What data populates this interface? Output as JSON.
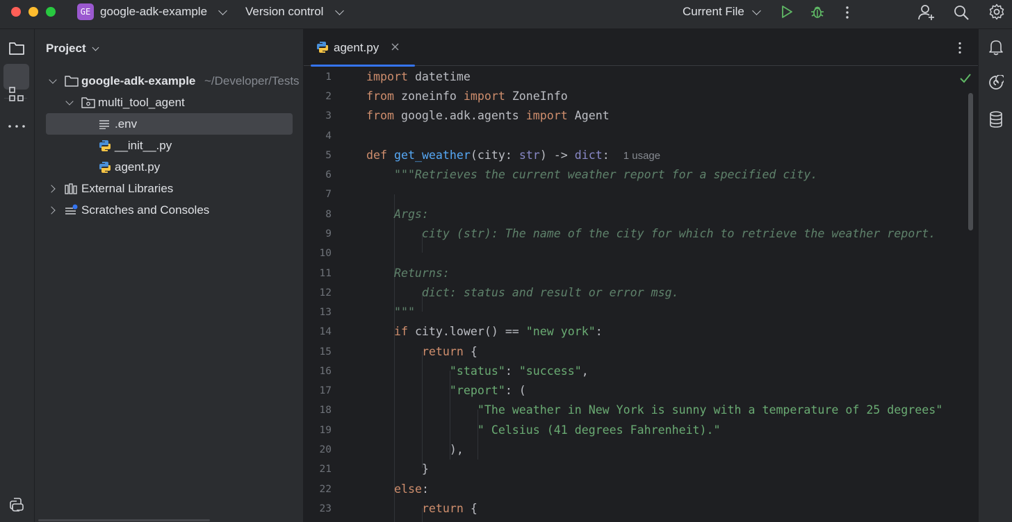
{
  "titlebar": {
    "project_badge": "GE",
    "project_name": "google-adk-example",
    "vcs_label": "Version control",
    "run_config": "Current File"
  },
  "project_panel": {
    "title": "Project",
    "tree": [
      {
        "label": "google-adk-example",
        "path": "~/Developer/Tests"
      },
      {
        "label": "multi_tool_agent"
      },
      {
        "label": ".env"
      },
      {
        "label": "__init__.py"
      },
      {
        "label": "agent.py"
      },
      {
        "label": "External Libraries"
      },
      {
        "label": "Scratches and Consoles"
      }
    ]
  },
  "editor": {
    "tab_label": "agent.py",
    "inlay_hint": "1 usage",
    "line_numbers": [
      "1",
      "2",
      "3",
      "4",
      "5",
      "6",
      "7",
      "8",
      "9",
      "10",
      "11",
      "12",
      "13",
      "14",
      "15",
      "16",
      "17",
      "18",
      "19",
      "20",
      "21",
      "22",
      "23"
    ]
  },
  "colors": {
    "keyword": "#cf8e6d",
    "function": "#56a8f5",
    "string": "#6aab73",
    "docstring": "#5f826b",
    "accent": "#3574f0"
  }
}
